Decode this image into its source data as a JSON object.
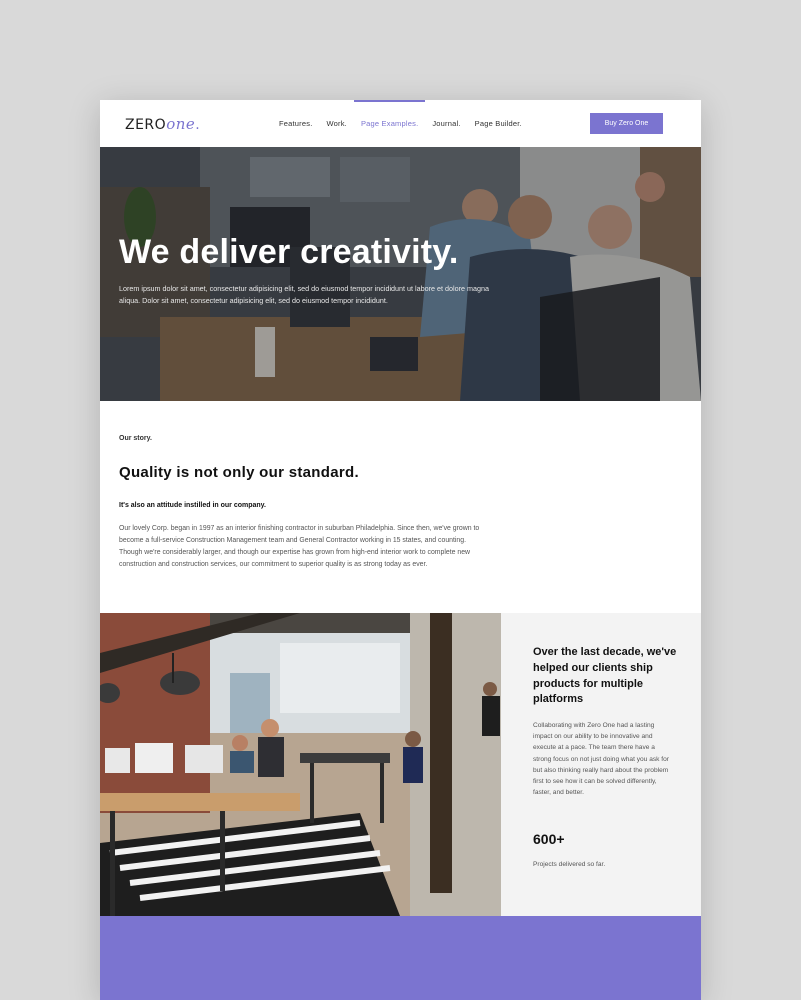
{
  "header": {
    "logo_part1": "ZERO",
    "logo_part2": "one",
    "logo_dot": ".",
    "nav": [
      {
        "label": "Features."
      },
      {
        "label": "Work."
      },
      {
        "label": "Page Examples."
      },
      {
        "label": "Journal."
      },
      {
        "label": "Page Builder."
      }
    ],
    "active_nav": "Page Examples.",
    "buy_label": "Buy Zero One"
  },
  "hero": {
    "title": "We deliver creativity.",
    "text": "Lorem ipsum dolor sit amet, consectetur adipisicing elit, sed do eiusmod tempor incididunt ut labore et dolore magna aliqua. Dolor sit amet, consectetur adipisicing elit, sed do eiusmod tempor incididunt."
  },
  "story": {
    "label": "Our story.",
    "title": "Quality is not only our standard.",
    "subtitle": "It's also an attitude instilled in our company.",
    "body": "Our lovely Corp. began in 1997 as an interior finishing contractor in suburban Philadelphia. Since then, we've grown to become a full-service Construction Management team and General Contractor working in 15 states, and counting. Though we're considerably larger, and though our expertise has grown from high-end interior work to complete new construction and construction services, our commitment to superior quality is as strong today as ever."
  },
  "decade": {
    "title": "Over the last decade, we've helped our clients ship products for multiple platforms",
    "body": "Collaborating with Zero One had a lasting impact on our ability to be innovative and execute at a pace. The team there have a strong focus on not just doing what you ask for but also thinking really hard about the problem first to see how it can be solved differently, faster, and better.",
    "stat": "600+",
    "stat_label": "Projects delivered so far."
  },
  "colors": {
    "accent": "#7b74d0",
    "panel": "#f3f3f3"
  }
}
